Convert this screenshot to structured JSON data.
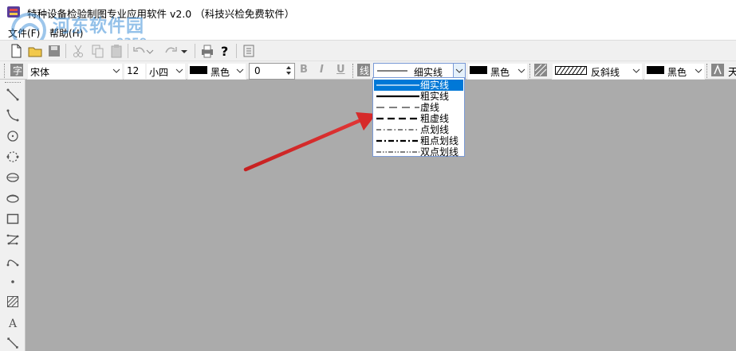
{
  "window": {
    "title": "特种设备检验制图专业应用软件 v2.0 （科技兴检免费软件）"
  },
  "watermark": {
    "text": "河东软件园",
    "url": "www.pc0359.cn"
  },
  "menu": [
    {
      "label": "文件(F)"
    },
    {
      "label": "帮助(H)"
    }
  ],
  "format_toolbar": {
    "font_name": "宋体",
    "font_size": "12",
    "font_size_name": "小四",
    "text_color": "黑色",
    "spin_value": "0",
    "bold": "B",
    "italic": "I",
    "underline": "U",
    "line_style": "细实线",
    "line_color": "黑色",
    "hatch_style": "反斜线",
    "hatch_color": "黑色",
    "truncated_label": "天"
  },
  "line_style_dropdown": {
    "selected_index": 0,
    "options": [
      {
        "label": "细实线",
        "pattern": "thin-solid"
      },
      {
        "label": "粗实线",
        "pattern": "thick-solid"
      },
      {
        "label": "虚线",
        "pattern": "dashed"
      },
      {
        "label": "粗虚线",
        "pattern": "thick-dashed"
      },
      {
        "label": "点划线",
        "pattern": "dash-dot"
      },
      {
        "label": "粗点划线",
        "pattern": "thick-dash-dot"
      },
      {
        "label": "双点划线",
        "pattern": "dash-dot-dot"
      }
    ]
  },
  "palette_tools": [
    "line-tool-icon",
    "curve-tool-icon",
    "circle-tool-icon",
    "arc-circle-tool-icon",
    "ellipse-tool-icon",
    "ellipse-arc-tool-icon",
    "rectangle-tool-icon",
    "polyline-tool-icon",
    "arc-tool-icon",
    "point-tool-icon",
    "hatch-tool-icon",
    "text-tool-icon",
    "dimension-tool-icon"
  ],
  "colors": {
    "canvas": "#ababab",
    "selection": "#0078d7",
    "arrow": "#d92a2a"
  }
}
